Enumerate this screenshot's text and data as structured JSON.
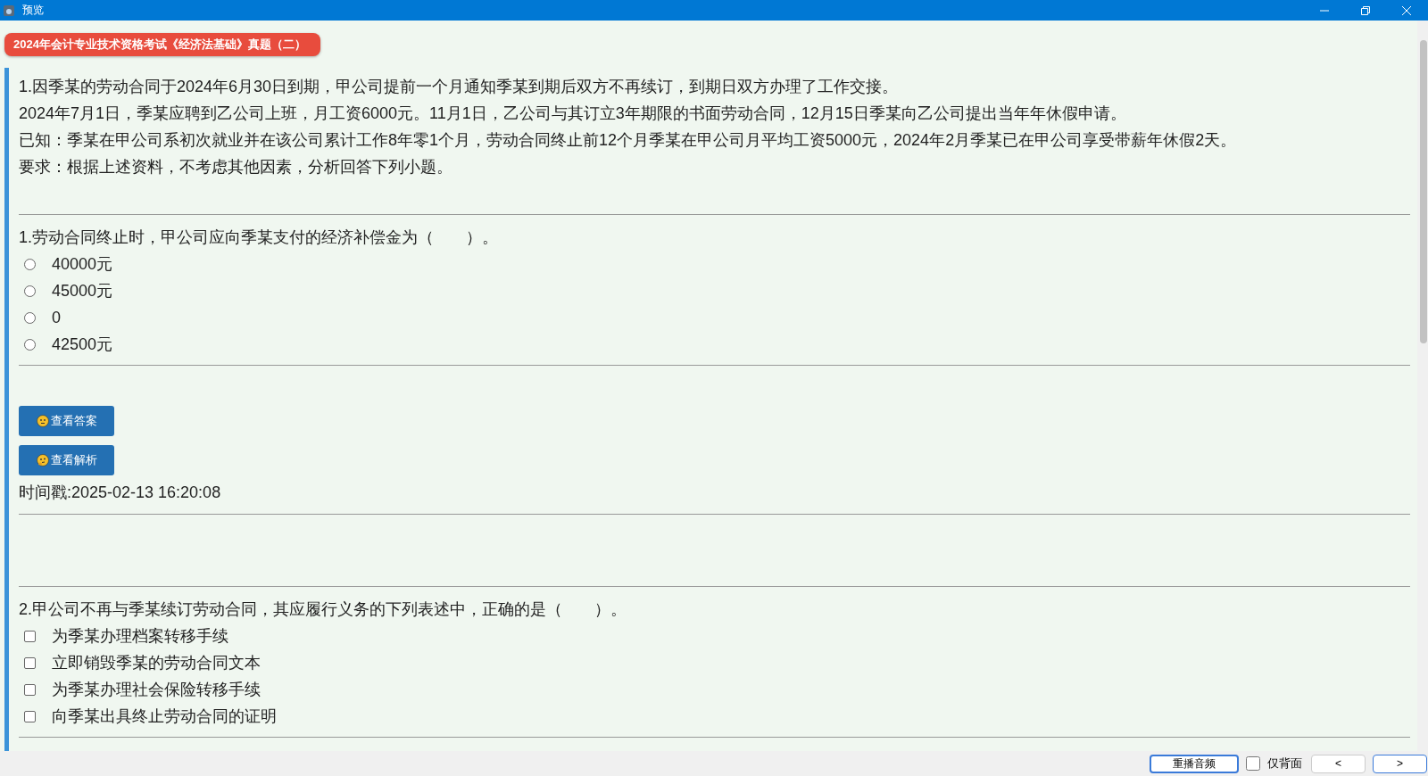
{
  "window": {
    "title": "预览"
  },
  "badge": "2024年会计专业技术资格考试《经济法基础》真题（二）",
  "passage": [
    "1.因季某的劳动合同于2024年6月30日到期，甲公司提前一个月通知季某到期后双方不再续订，到期日双方办理了工作交接。",
    "2024年7月1日，季某应聘到乙公司上班，月工资6000元。11月1日，乙公司与其订立3年期限的书面劳动合同，12月15日季某向乙公司提出当年年休假申请。",
    "已知：季某在甲公司系初次就业并在该公司累计工作8年零1个月，劳动合同终止前12个月季某在甲公司月平均工资5000元，2024年2月季某已在甲公司享受带薪年休假2天。",
    "要求：根据上述资料，不考虑其他因素，分析回答下列小题。"
  ],
  "questions": [
    {
      "kind": "single",
      "stem": "1.劳动合同终止时，甲公司应向季某支付的经济补偿金为（　　）。",
      "options": [
        {
          "label": "40000元",
          "selected": false
        },
        {
          "label": "45000元",
          "selected": false
        },
        {
          "label": "0",
          "selected": false
        },
        {
          "label": "42500元",
          "selected": false
        }
      ],
      "buttons": [
        {
          "label": "查看答案",
          "kind": "answer"
        },
        {
          "label": "查看解析",
          "kind": "explanation"
        }
      ],
      "timestamp": "时间戳:2025-02-13 16:20:08"
    },
    {
      "kind": "multiple",
      "stem": "2.甲公司不再与季某续订劳动合同，其应履行义务的下列表述中，正确的是（　　）。",
      "options": [
        {
          "label": "为季某办理档案转移手续",
          "selected": false
        },
        {
          "label": "立即销毁季某的劳动合同文本",
          "selected": false
        },
        {
          "label": "为季某办理社会保险转移手续",
          "selected": false
        },
        {
          "label": "向季某出具终止劳动合同的证明",
          "selected": false
        }
      ]
    }
  ],
  "bottom_bar": {
    "replay": "重播音频",
    "back_only": {
      "label": "仅背面",
      "checked": false
    },
    "prev": "<",
    "next": ">"
  }
}
